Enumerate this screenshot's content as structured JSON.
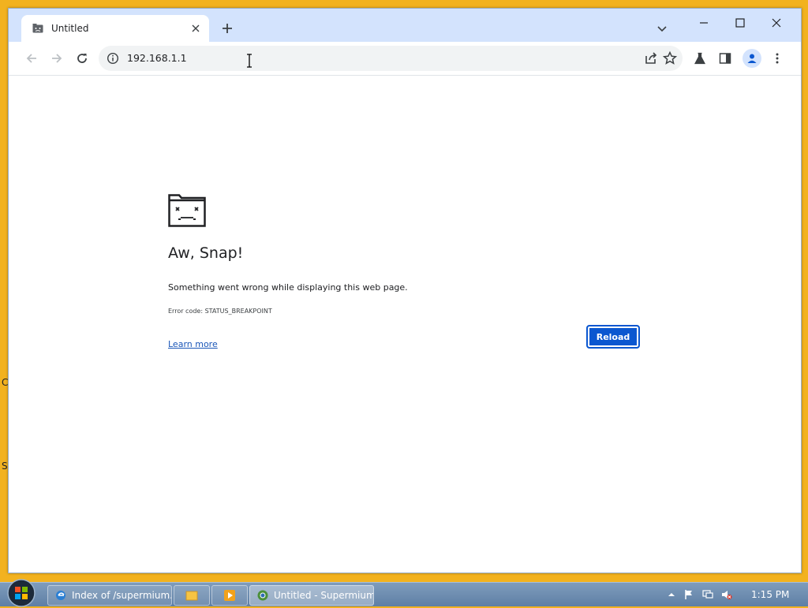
{
  "browser": {
    "tab": {
      "title": "Untitled",
      "favicon": "sad-tab-icon"
    },
    "address": {
      "url": "192.168.1.1"
    }
  },
  "error_page": {
    "heading": "Aw, Snap!",
    "message": "Something went wrong while displaying this web page.",
    "error_code": "Error code: STATUS_BREAKPOINT",
    "learn_more": "Learn more",
    "reload": "Reload"
  },
  "taskbar": {
    "items": [
      {
        "label": "Index of /supermium...",
        "icon": "internet-explorer-icon"
      },
      {
        "label": "",
        "icon": "folder-icon"
      },
      {
        "label": "",
        "icon": "media-player-icon"
      },
      {
        "label": "Untitled - Supermium",
        "icon": "supermium-icon",
        "active": true
      }
    ],
    "clock": "1:15 PM"
  },
  "desktop": {
    "edge_chars": [
      "C",
      "S"
    ]
  },
  "colors": {
    "desktop": "#f2b21f",
    "titlebar": "#d3e3fd",
    "accent": "#0b57d0",
    "link": "#1a56b8"
  }
}
